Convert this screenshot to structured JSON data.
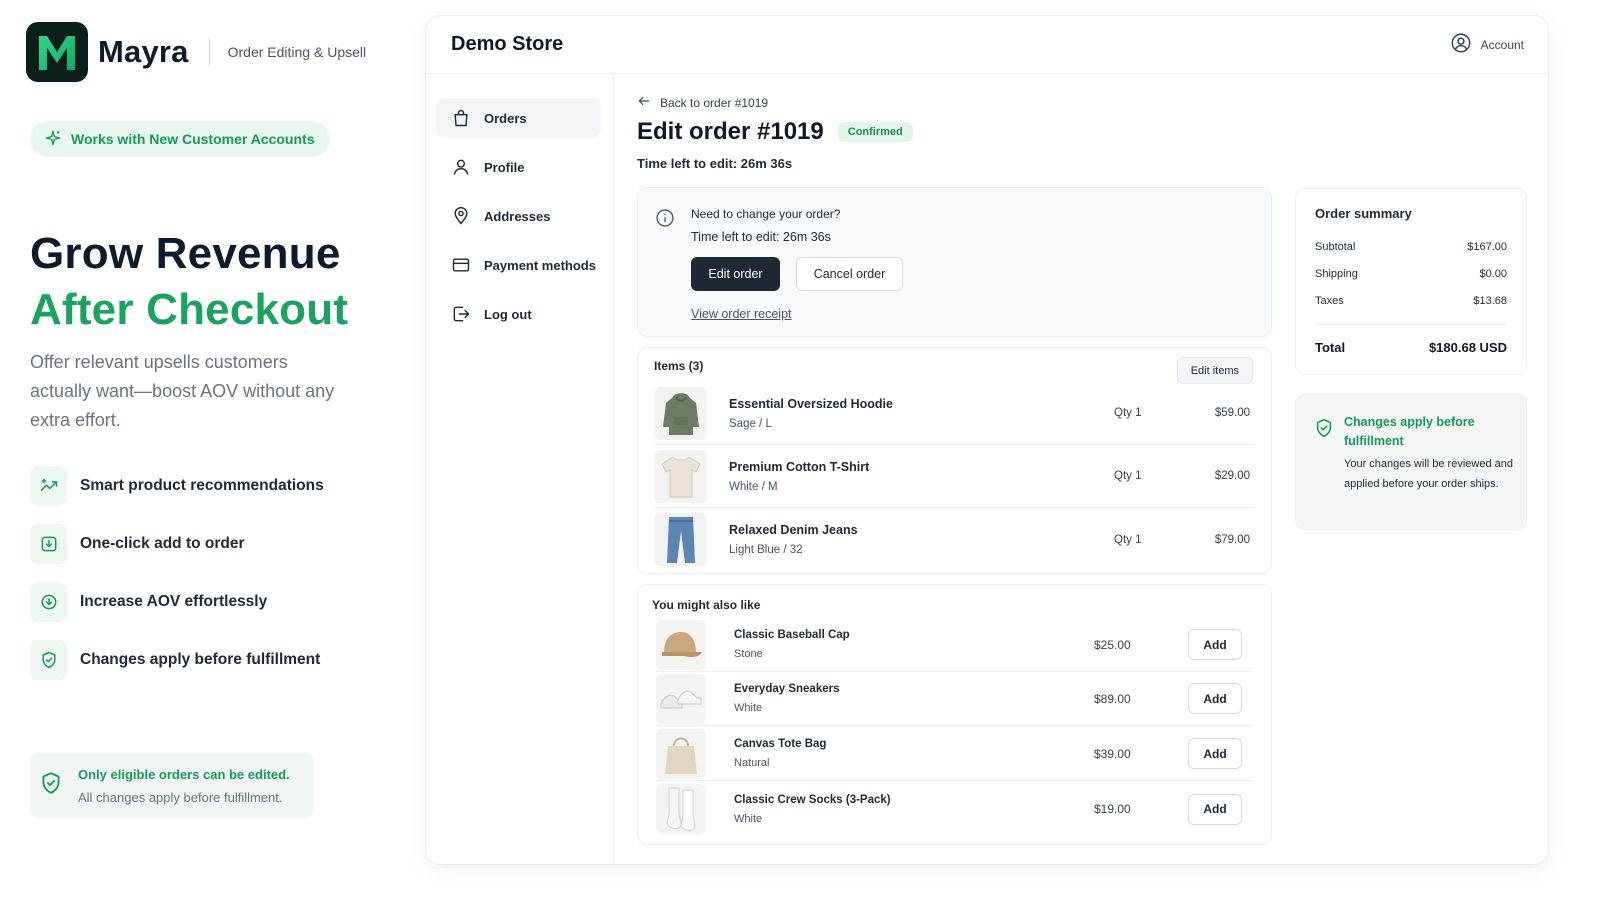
{
  "brand": {
    "name": "Mayra",
    "tagline": "Order Editing & Upsell",
    "pill": "Works with New Customer Accounts"
  },
  "hero": {
    "line1": "Grow Revenue",
    "line2": "After Checkout",
    "subtitle": "Offer relevant upsells customers actually want—boost AOV without any extra effort."
  },
  "features": [
    {
      "label": "Smart product recommendations",
      "icon": "sparkle-trend-icon"
    },
    {
      "label": "One-click add to order",
      "icon": "download-box-icon"
    },
    {
      "label": "Increase AOV effortlessly",
      "icon": "arrow-circle-icon"
    },
    {
      "label": "Changes apply before fulfillment",
      "icon": "shield-check-icon"
    }
  ],
  "note": {
    "line1": "Only eligible orders can be edited.",
    "line2": "All changes apply before fulfillment."
  },
  "app": {
    "store_name": "Demo Store",
    "account_label": "Account"
  },
  "sidebar": {
    "items": [
      {
        "label": "Orders",
        "icon": "shopping-bag-icon"
      },
      {
        "label": "Profile",
        "icon": "user-icon"
      },
      {
        "label": "Addresses",
        "icon": "map-pin-icon"
      },
      {
        "label": "Payment methods",
        "icon": "credit-card-icon"
      },
      {
        "label": "Log out",
        "icon": "logout-icon"
      }
    ]
  },
  "order": {
    "back_label": "Back to order #1019",
    "title": "Edit order #1019",
    "status": "Confirmed",
    "time_left": "Time left to edit: 26m 36s"
  },
  "change_card": {
    "line1": "Need to change your order?",
    "line2": "Time left to edit: 26m 36s",
    "edit_btn": "Edit order",
    "cancel_btn": "Cancel order",
    "receipt_link": "View order receipt"
  },
  "items": {
    "title": "Items (3)",
    "edit_btn": "Edit items",
    "rows": [
      {
        "name": "Essential Oversized Hoodie",
        "variant": "Sage / L",
        "qty": "Qty 1",
        "price": "$59.00"
      },
      {
        "name": "Premium Cotton T-Shirt",
        "variant": "White / M",
        "qty": "Qty 1",
        "price": "$29.00"
      },
      {
        "name": "Relaxed Denim Jeans",
        "variant": "Light Blue / 32",
        "qty": "Qty 1",
        "price": "$79.00"
      }
    ]
  },
  "upsell": {
    "title": "You might also like",
    "add_label": "Add",
    "rows": [
      {
        "name": "Classic Baseball Cap",
        "variant": "Stone",
        "price": "$25.00"
      },
      {
        "name": "Everyday Sneakers",
        "variant": "White",
        "price": "$89.00"
      },
      {
        "name": "Canvas Tote Bag",
        "variant": "Natural",
        "price": "$39.00"
      },
      {
        "name": "Classic Crew Socks (3-Pack)",
        "variant": "White",
        "price": "$19.00"
      }
    ]
  },
  "summary": {
    "title": "Order summary",
    "subtotal_label": "Subtotal",
    "subtotal": "$167.00",
    "shipping_label": "Shipping",
    "shipping": "$0.00",
    "taxes_label": "Taxes",
    "taxes": "$13.68",
    "total_label": "Total",
    "total": "$180.68 USD"
  },
  "fulfillment": {
    "title": "Changes apply before fulfillment",
    "body": "Your changes will be reviewed and applied before your order ships."
  },
  "colors": {
    "brand_green": "#1aa25f",
    "navy": "#0f1b2d",
    "dark_button": "#1f2933"
  }
}
